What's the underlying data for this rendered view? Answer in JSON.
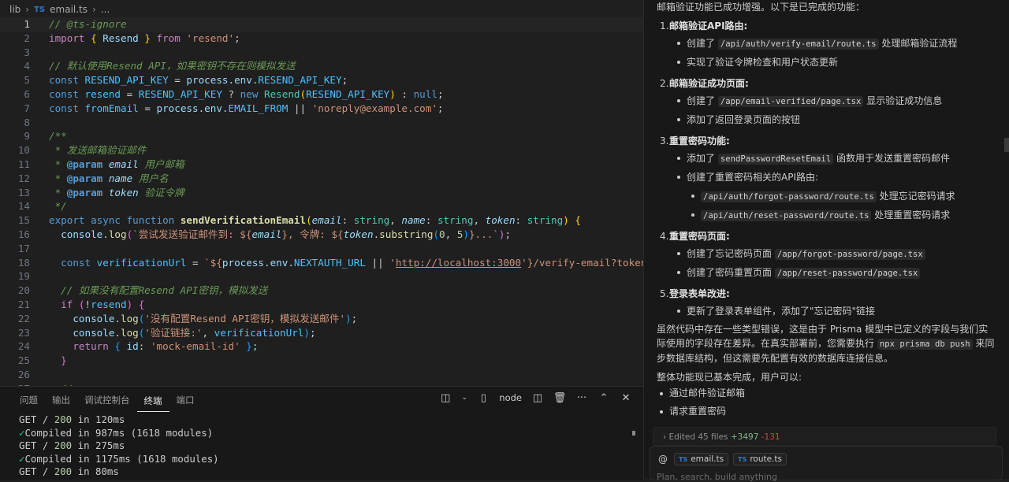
{
  "breadcrumb": {
    "folder": "lib",
    "file_type": "TS",
    "file": "email.ts",
    "more": "..."
  },
  "panel": {
    "tabs": [
      "问题",
      "输出",
      "调试控制台",
      "终端",
      "端口"
    ],
    "active_tab": "终端",
    "terminal_label": "node",
    "lines": [
      {
        "pre": "GET / ",
        "num": "200",
        "post": " in 120ms",
        "check": false
      },
      {
        "pre": "Compiled in 987ms (1618 modules)",
        "num": "",
        "post": "",
        "check": true
      },
      {
        "pre": "GET / ",
        "num": "200",
        "post": " in 275ms",
        "check": false
      },
      {
        "pre": "Compiled in 1175ms (1618 modules)",
        "num": "",
        "post": "",
        "check": true
      },
      {
        "pre": "GET / ",
        "num": "200",
        "post": " in 80ms",
        "check": false
      }
    ]
  },
  "code_lines": [
    [
      [
        "cmt",
        "// @ts-ignore"
      ]
    ],
    [
      [
        "kw2",
        "import "
      ],
      [
        "br1",
        "{ "
      ],
      [
        "var",
        "Resend"
      ],
      [
        "br1",
        " }"
      ],
      [
        "kw2",
        " from "
      ],
      [
        "str",
        "'resend'"
      ],
      [
        "",
        "; "
      ]
    ],
    [],
    [
      [
        "cmt",
        "// 默认使用Resend API，如果密钥不存在则模拟发送"
      ]
    ],
    [
      [
        "kw",
        "const "
      ],
      [
        "cst",
        "RESEND_API_KEY"
      ],
      [
        "",
        " = "
      ],
      [
        "var",
        "process"
      ],
      [
        "",
        "."
      ],
      [
        "var",
        "env"
      ],
      [
        "",
        "."
      ],
      [
        "cst",
        "RESEND_API_KEY"
      ],
      [
        "",
        ";"
      ]
    ],
    [
      [
        "kw",
        "const "
      ],
      [
        "cst",
        "resend"
      ],
      [
        "",
        " = "
      ],
      [
        "cst",
        "RESEND_API_KEY"
      ],
      [
        "",
        " ? "
      ],
      [
        "kw",
        "new "
      ],
      [
        "ty",
        "Resend"
      ],
      [
        "br1",
        "("
      ],
      [
        "cst",
        "RESEND_API_KEY"
      ],
      [
        "br1",
        ")"
      ],
      [
        "",
        " : "
      ],
      [
        "kw",
        "null"
      ],
      [
        "",
        ";"
      ]
    ],
    [
      [
        "kw",
        "const "
      ],
      [
        "cst",
        "fromEmail"
      ],
      [
        "",
        " = "
      ],
      [
        "var",
        "process"
      ],
      [
        "",
        "."
      ],
      [
        "var",
        "env"
      ],
      [
        "",
        "."
      ],
      [
        "cst",
        "EMAIL_FROM"
      ],
      [
        "",
        " || "
      ],
      [
        "str",
        "'noreply@example.com'"
      ],
      [
        "",
        ";"
      ]
    ],
    [],
    [
      [
        "cmt",
        "/**"
      ]
    ],
    [
      [
        "cmt",
        " * 发送邮箱验证邮件"
      ]
    ],
    [
      [
        "cmt",
        " * "
      ],
      [
        "tag",
        "@param"
      ],
      [
        "param",
        " email"
      ],
      [
        "cmt",
        " 用户邮箱"
      ]
    ],
    [
      [
        "cmt",
        " * "
      ],
      [
        "tag",
        "@param"
      ],
      [
        "param",
        " name"
      ],
      [
        "cmt",
        " 用户名"
      ]
    ],
    [
      [
        "cmt",
        " * "
      ],
      [
        "tag",
        "@param"
      ],
      [
        "param",
        " token"
      ],
      [
        "cmt",
        " 验证令牌"
      ]
    ],
    [
      [
        "cmt",
        " */"
      ]
    ],
    [
      [
        "kw",
        "export "
      ],
      [
        "kw",
        "async "
      ],
      [
        "kw",
        "function "
      ],
      [
        "fnb",
        "sendVerificationEmail"
      ],
      [
        "br1",
        "("
      ],
      [
        "param",
        "email"
      ],
      [
        "",
        ": "
      ],
      [
        "ty",
        "string"
      ],
      [
        "",
        ", "
      ],
      [
        "param",
        "name"
      ],
      [
        "",
        ": "
      ],
      [
        "ty",
        "string"
      ],
      [
        "",
        ", "
      ],
      [
        "param",
        "token"
      ],
      [
        "",
        ": "
      ],
      [
        "ty",
        "string"
      ],
      [
        "br1",
        ")"
      ],
      [
        "",
        " "
      ],
      [
        "br1",
        "{"
      ]
    ],
    [
      [
        "",
        "  "
      ],
      [
        "var",
        "console"
      ],
      [
        "",
        "."
      ],
      [
        "fn",
        "log"
      ],
      [
        "br2",
        "("
      ],
      [
        "tmpl",
        "`尝试发送验证邮件到: ${"
      ],
      [
        "param",
        "email"
      ],
      [
        "tmpl",
        "}, 令牌: ${"
      ],
      [
        "param",
        "token"
      ],
      [
        "",
        "."
      ],
      [
        "fn",
        "substring"
      ],
      [
        "br3",
        "("
      ],
      [
        "num",
        "0"
      ],
      [
        "",
        ", "
      ],
      [
        "num",
        "5"
      ],
      [
        "br3",
        ")"
      ],
      [
        "tmpl",
        "}...`"
      ],
      [
        "br2",
        ")"
      ],
      [
        "",
        ";"
      ]
    ],
    [],
    [
      [
        "",
        "  "
      ],
      [
        "kw",
        "const "
      ],
      [
        "cst",
        "verificationUrl"
      ],
      [
        "",
        " = "
      ],
      [
        "tmpl",
        "`${"
      ],
      [
        "var",
        "process"
      ],
      [
        "",
        "."
      ],
      [
        "var",
        "env"
      ],
      [
        "",
        "."
      ],
      [
        "cst",
        "NEXTAUTH_URL"
      ],
      [
        "",
        " || "
      ],
      [
        "str",
        "'"
      ],
      [
        "link",
        "http://localhost:3000"
      ],
      [
        "str",
        "'"
      ],
      [
        "tmpl",
        "}/verify-email?token=${t"
      ]
    ],
    [],
    [
      [
        "",
        "  "
      ],
      [
        "cmt",
        "// 如果没有配置Resend API密钥，模拟发送"
      ]
    ],
    [
      [
        "",
        "  "
      ],
      [
        "kw2",
        "if "
      ],
      [
        "br2",
        "("
      ],
      [
        "",
        "!"
      ],
      [
        "cst",
        "resend"
      ],
      [
        "br2",
        ")"
      ],
      [
        "",
        " "
      ],
      [
        "br2",
        "{"
      ]
    ],
    [
      [
        "",
        "    "
      ],
      [
        "var",
        "console"
      ],
      [
        "",
        "."
      ],
      [
        "fn",
        "log"
      ],
      [
        "br3",
        "("
      ],
      [
        "str",
        "'没有配置Resend API密钥，模拟发送邮件'"
      ],
      [
        "br3",
        ")"
      ],
      [
        "",
        ";"
      ]
    ],
    [
      [
        "",
        "    "
      ],
      [
        "var",
        "console"
      ],
      [
        "",
        "."
      ],
      [
        "fn",
        "log"
      ],
      [
        "br3",
        "("
      ],
      [
        "str",
        "'验证链接:'"
      ],
      [
        "",
        ", "
      ],
      [
        "cst",
        "verificationUrl"
      ],
      [
        "br3",
        ")"
      ],
      [
        "",
        ";"
      ]
    ],
    [
      [
        "",
        "    "
      ],
      [
        "kw2",
        "return "
      ],
      [
        "br3",
        "{ "
      ],
      [
        "var",
        "id"
      ],
      [
        "",
        ": "
      ],
      [
        "str",
        "'mock-email-id'"
      ],
      [
        "br3",
        " }"
      ],
      [
        "",
        ";"
      ]
    ],
    [
      [
        "",
        "  "
      ],
      [
        "br2",
        "}"
      ]
    ],
    [],
    [
      [
        "",
        "  "
      ],
      [
        "cmt",
        "// ..."
      ]
    ]
  ],
  "chat": {
    "intro": "邮箱验证功能已成功增强。以下是已完成的功能：",
    "sections": [
      {
        "num": "1.",
        "title": "邮箱验证API路由:",
        "items": [
          {
            "level": 1,
            "parts": [
              [
                "t",
                "创建了 "
              ],
              [
                "c",
                "/api/auth/verify-email/route.ts"
              ],
              [
                "t",
                " 处理邮箱验证流程"
              ]
            ]
          },
          {
            "level": 1,
            "parts": [
              [
                "t",
                "实现了验证令牌检查和用户状态更新"
              ]
            ]
          }
        ]
      },
      {
        "num": "2.",
        "title": "邮箱验证成功页面:",
        "items": [
          {
            "level": 1,
            "parts": [
              [
                "t",
                "创建了 "
              ],
              [
                "c",
                "/app/email-verified/page.tsx"
              ],
              [
                "t",
                " 显示验证成功信息"
              ]
            ]
          },
          {
            "level": 1,
            "parts": [
              [
                "t",
                "添加了返回登录页面的按钮"
              ]
            ]
          }
        ]
      },
      {
        "num": "3.",
        "title": "重置密码功能:",
        "items": [
          {
            "level": 1,
            "parts": [
              [
                "t",
                "添加了 "
              ],
              [
                "c",
                "sendPasswordResetEmail"
              ],
              [
                "t",
                " 函数用于发送重置密码邮件"
              ]
            ]
          },
          {
            "level": 1,
            "parts": [
              [
                "t",
                "创建了重置密码相关的API路由:"
              ]
            ]
          },
          {
            "level": 2,
            "parts": [
              [
                "c",
                "/api/auth/forgot-password/route.ts"
              ],
              [
                "t",
                " 处理忘记密码请求"
              ]
            ]
          },
          {
            "level": 2,
            "parts": [
              [
                "c",
                "/api/auth/reset-password/route.ts"
              ],
              [
                "t",
                " 处理重置密码请求"
              ]
            ]
          }
        ]
      },
      {
        "num": "4.",
        "title": "重置密码页面:",
        "items": [
          {
            "level": 1,
            "parts": [
              [
                "t",
                "创建了忘记密码页面 "
              ],
              [
                "c",
                "/app/forgot-password/page.tsx"
              ]
            ]
          },
          {
            "level": 1,
            "parts": [
              [
                "t",
                "创建了密码重置页面 "
              ],
              [
                "c",
                "/app/reset-password/page.tsx"
              ]
            ]
          }
        ]
      },
      {
        "num": "5.",
        "title": "登录表单改进:",
        "items": [
          {
            "level": 1,
            "parts": [
              [
                "t",
                "更新了登录表单组件，添加了\"忘记密码\"链接"
              ]
            ]
          }
        ]
      }
    ],
    "note_parts": [
      [
        "t",
        "虽然代码中存在一些类型错误，这是由于 Prisma 模型中已定义的字段与我们实际使用的字段存在差异。在真实部署前，您需要执行 "
      ],
      [
        "c",
        "npx prisma db push"
      ],
      [
        "t",
        " 来同步数据库结构，但这需要先配置有效的数据库连接信息。"
      ]
    ],
    "summary": "整体功能现已基本完成，用户可以:",
    "summary_items": [
      "通过邮件验证邮箱",
      "请求重置密码"
    ],
    "edited": {
      "chevron": "›",
      "label": "Edited 45 files",
      "added": "+3497",
      "removed": "-131"
    },
    "context_chips": [
      "email.ts",
      "route.ts"
    ],
    "input_placeholder": "Plan, search, build anything"
  }
}
